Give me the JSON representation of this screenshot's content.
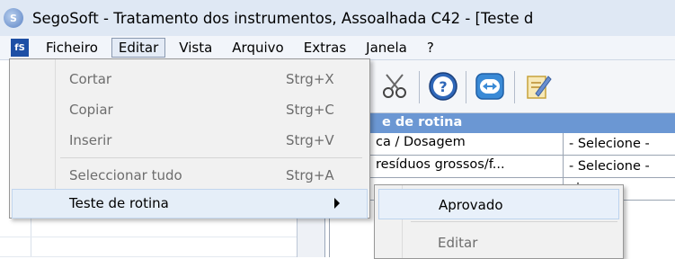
{
  "window": {
    "title": "SegoSoft - Tratamento dos instrumentos, Assoalhada C42 - [Teste d"
  },
  "menubar": {
    "items": [
      {
        "label": "Ficheiro"
      },
      {
        "label": "Editar"
      },
      {
        "label": "Vista"
      },
      {
        "label": "Arquivo"
      },
      {
        "label": "Extras"
      },
      {
        "label": "Janela"
      },
      {
        "label": "?"
      }
    ]
  },
  "edit_menu": {
    "items": [
      {
        "label": "Cortar",
        "shortcut": "Strg+X",
        "state": "disabled"
      },
      {
        "label": "Copiar",
        "shortcut": "Strg+C",
        "state": "disabled"
      },
      {
        "label": "Inserir",
        "shortcut": "Strg+V",
        "state": "disabled"
      },
      {
        "label": "Seleccionar tudo",
        "shortcut": "Strg+A",
        "state": "disabled"
      },
      {
        "label": "Teste de rotina",
        "shortcut": "",
        "state": "highlighted"
      }
    ]
  },
  "submenu": {
    "items": [
      {
        "label": "Aprovado",
        "state": "highlighted"
      },
      {
        "label": "Editar",
        "state": "disabled"
      }
    ]
  },
  "grid": {
    "header": "e de rotina",
    "rows": [
      {
        "c1": "ca / Dosagem",
        "c2": "- Selecione -"
      },
      {
        "c1": "resíduos grossos/f...",
        "c2": "- Selecione -"
      },
      {
        "c1": "",
        "c2": "cione -"
      }
    ]
  },
  "colors": {
    "grid_header": "#6b97d3",
    "menu_highlight": "#e5eef8"
  },
  "icons": [
    "cut-icon",
    "help-icon",
    "connect-icon",
    "edit-document-icon"
  ]
}
